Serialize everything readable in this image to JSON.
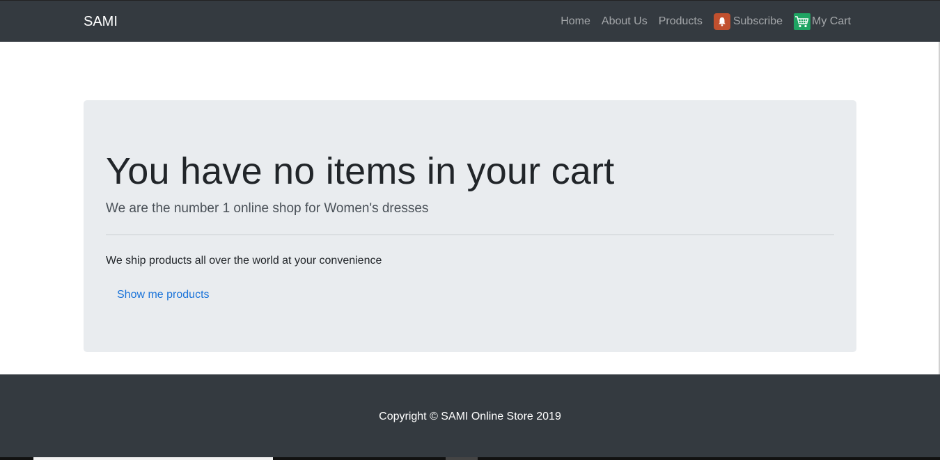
{
  "navbar": {
    "brand": "SAMI",
    "links": [
      {
        "label": "Home"
      },
      {
        "label": "About Us"
      },
      {
        "label": "Products"
      },
      {
        "label": "Subscribe",
        "icon": "bell-icon"
      },
      {
        "label": "My Cart",
        "icon": "shopping-cart-icon"
      }
    ]
  },
  "jumbotron": {
    "title": "You have no items in your cart",
    "lead": "We are the number 1 online shop for Women's dresses",
    "body": "We ship products all over the world at your convenience",
    "button_label": "Show me products"
  },
  "footer": {
    "copyright": "Copyright © SAMI Online Store 2019"
  },
  "colors": {
    "navbar_bg": "#343a40",
    "jumbotron_bg": "#e9ecef",
    "link_blue": "#1a73d9",
    "subscribe_icon_bg": "#c1502e",
    "cart_icon_bg": "#1fa463"
  }
}
